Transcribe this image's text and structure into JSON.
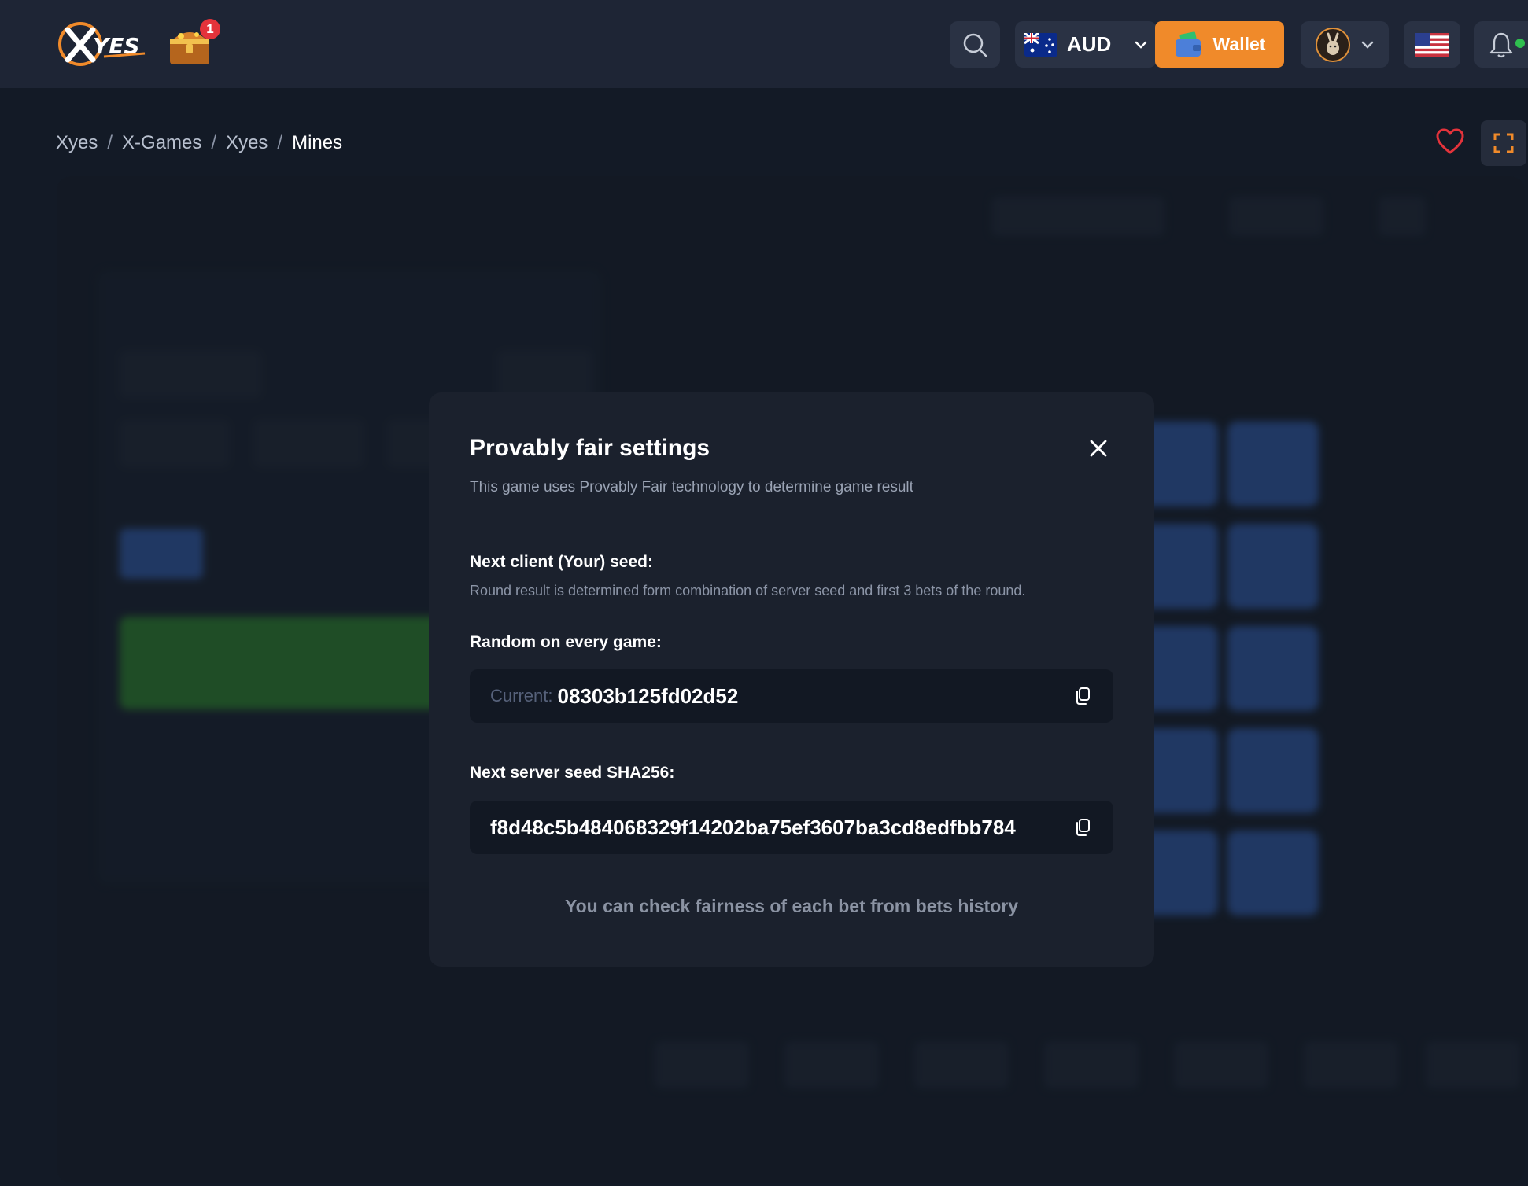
{
  "header": {
    "logo_text": "XYES",
    "chest_badge": "1",
    "currency": "AUD",
    "wallet_label": "Wallet"
  },
  "breadcrumb": {
    "items": [
      "Xyes",
      "X-Games",
      "Xyes"
    ],
    "separator": "/",
    "current": "Mines"
  },
  "modal": {
    "title": "Provably fair settings",
    "subtitle": "This game uses Provably Fair technology to determine game result",
    "client_seed_label": "Next client (Your) seed:",
    "client_seed_note": "Round result is determined form combination of server seed and first 3 bets of the round.",
    "random_label": "Random on every game:",
    "current_prefix": "Current:",
    "current_seed": "08303b125fd02d52",
    "server_seed_label": "Next server seed SHA256:",
    "server_seed": "f8d48c5b484068329f14202ba75ef3607ba3cd8edfbb784",
    "footer_note": "You can check fairness of each bet from bets history"
  },
  "colors": {
    "accent_orange": "#f08a2a",
    "favorite_red": "#e4333b",
    "online_green": "#2fbf4f"
  },
  "icons": [
    "search-icon",
    "australia-flag-icon",
    "chevron-down-icon",
    "wallet-icon",
    "user-avatar-icon",
    "us-flag-icon",
    "bell-icon",
    "heart-icon",
    "fullscreen-icon",
    "close-icon",
    "copy-icon"
  ]
}
